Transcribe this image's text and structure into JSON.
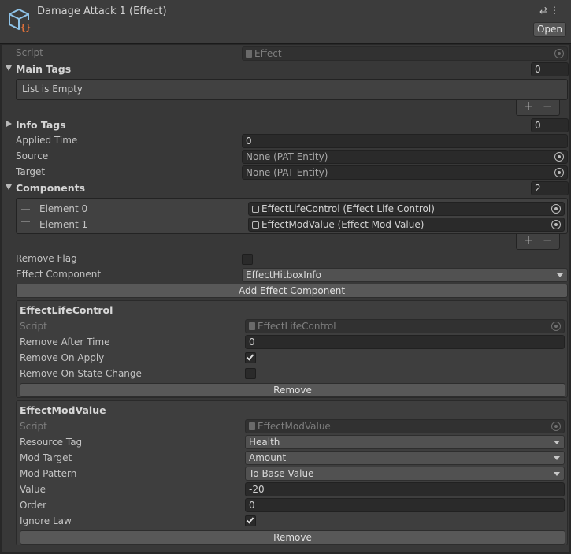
{
  "header": {
    "title": "Damage Attack 1 (Effect)",
    "open_label": "Open",
    "tools_icons": [
      "sliders-icon",
      "kebab-menu-icon"
    ]
  },
  "script": {
    "label": "Script",
    "value": "Effect"
  },
  "main_tags": {
    "label": "Main Tags",
    "count": "0",
    "empty_text": "List is Empty",
    "add": "+",
    "remove": "−"
  },
  "info_tags": {
    "label": "Info Tags",
    "count": "0"
  },
  "applied_time": {
    "label": "Applied Time",
    "value": "0"
  },
  "source": {
    "label": "Source",
    "value": "None (PAT Entity)"
  },
  "target": {
    "label": "Target",
    "value": "None (PAT Entity)"
  },
  "components": {
    "label": "Components",
    "count": "2",
    "elements": [
      {
        "label": "Element 0",
        "value": "EffectLifeControl (Effect Life Control)"
      },
      {
        "label": "Element 1",
        "value": "EffectModValue (Effect Mod Value)"
      }
    ],
    "add": "+",
    "remove": "−"
  },
  "remove_flag": {
    "label": "Remove Flag",
    "checked": false
  },
  "effect_component": {
    "label": "Effect Component",
    "value": "EffectHitboxInfo"
  },
  "add_effect_component_label": "Add Effect Component",
  "life_control": {
    "title": "EffectLifeControl",
    "script_label": "Script",
    "script_value": "EffectLifeControl",
    "remove_after_time_label": "Remove After Time",
    "remove_after_time_value": "0",
    "remove_on_apply_label": "Remove On Apply",
    "remove_on_apply": true,
    "remove_on_state_change_label": "Remove On State Change",
    "remove_on_state_change": false,
    "remove_label": "Remove"
  },
  "mod_value": {
    "title": "EffectModValue",
    "script_label": "Script",
    "script_value": "EffectModValue",
    "resource_tag_label": "Resource Tag",
    "resource_tag_value": "Health",
    "mod_target_label": "Mod Target",
    "mod_target_value": "Amount",
    "mod_pattern_label": "Mod Pattern",
    "mod_pattern_value": "To Base Value",
    "value_label": "Value",
    "value_value": "-20",
    "order_label": "Order",
    "order_value": "0",
    "ignore_law_label": "Ignore Law",
    "ignore_law": true,
    "remove_label": "Remove"
  },
  "colors": {
    "background": "#383838",
    "field": "#2a2a2a",
    "button": "#585858",
    "icon_orange": "#e8733a",
    "icon_blue": "#8fc3e8"
  }
}
